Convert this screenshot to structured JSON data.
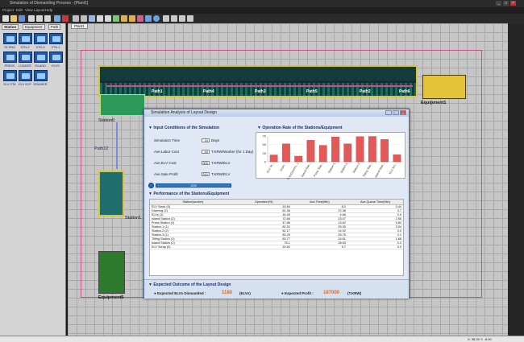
{
  "window": {
    "title": "Simulation of Dismantling Process - [Plant1]",
    "controls": [
      "_",
      "□",
      "×"
    ]
  },
  "menu": [
    "Project",
    "Edit",
    "View",
    "Layout",
    "Help"
  ],
  "left_panel": {
    "tabs": [
      "Station",
      "Equipment",
      "Path"
    ],
    "items": [
      "TILTING",
      "STN-2",
      "STN-3",
      "STN-1",
      "PRESS",
      "LOADER",
      "ISLAND",
      "ELVS",
      "ELV STA",
      "ELV SCP",
      "DRAINER"
    ]
  },
  "canvas_tab": "Plant1",
  "canvas": {
    "paths": [
      "Path1",
      "Path4",
      "Path3",
      "Path5",
      "Path2",
      "Path6"
    ],
    "labels": {
      "station0": "Station0",
      "path12": "Path12",
      "station1": "Station1",
      "equipment1": "Equipment1",
      "equipment6": "Equipment6"
    }
  },
  "modal": {
    "title": "Simulation Analysis of Layout Design",
    "input_section": "Input Conditions of the Simulation",
    "inputs": [
      {
        "label": "Simulation Time",
        "value": "10",
        "unit": "Days"
      },
      {
        "label": "Ave.Labor Cost",
        "value": "50",
        "unit": "T.KRW/Worker (for 1 Day)"
      },
      {
        "label": "Ave.ELV Cost",
        "value": "300",
        "unit": "T.KRW/ELV"
      },
      {
        "label": "Ave.Sale Profit",
        "value": "310",
        "unit": "T.KRW/ELV"
      }
    ],
    "progress_text": "1000",
    "progress_fraction": 1.0,
    "operation_section": "Operation Rate of the Stations/Equipment",
    "performance_section": "Performance of the Stations/Equipment",
    "table": {
      "headers": [
        "Station(worker)",
        "Operation(%)",
        "Ave.Time(Min)",
        "Ave.Queue Time(Min)"
      ],
      "rows": [
        [
          "ELV Stack (0)",
          "19.84",
          "8.0",
          "0.44"
        ],
        [
          "Draining (2)",
          "62.36",
          "22.38",
          "4.7"
        ],
        [
          "ELVs (1)",
          "16.45",
          "4.66",
          "0.0"
        ],
        [
          "Island Station (2)",
          "72.66",
          "23.07",
          "2.56"
        ],
        [
          "Press Station (1)",
          "47.86",
          "13.62",
          "9.84"
        ],
        [
          "Station-1 (1)",
          "82.52",
          "26.35",
          "3.34"
        ],
        [
          "Station-2 (2)",
          "52.17",
          "14.92",
          "0.0"
        ],
        [
          "Station-3 (1)",
          "83.29",
          "25.75",
          "2.1"
        ],
        [
          "Tilting Station (1)",
          "83.77",
          "24.61",
          "1.68"
        ],
        [
          "Island Station (2)",
          "75.1",
          "28.63",
          "0.0"
        ],
        [
          "ELV Scrap (0)",
          "20.62",
          "5.7",
          "0.0"
        ]
      ]
    },
    "outcome_section": "Expected Outcome of the Layout Design",
    "outcome": {
      "dismantled_label": "Expected ELVs Dismantled :",
      "dismantled_value": "1180",
      "dismantled_unit": "(ELVs)",
      "profit_label": "Expected Profit :",
      "profit_value": "187000",
      "profit_unit": "(T.KRW)"
    }
  },
  "chart_data": {
    "type": "bar",
    "title": "",
    "ylim": [
      0,
      75
    ],
    "yticks": [
      0,
      25,
      50,
      75
    ],
    "categories": [
      "ELV St...",
      "Drain...",
      "ELVs(Dismin...)",
      "Island Stat...",
      "Press Stat...",
      "Station-1",
      "Station-2",
      "Station-3",
      "Tilting Stat...",
      "Island Stati...",
      "ELV Scr..."
    ],
    "values": [
      19.84,
      52.36,
      16.45,
      62.66,
      47.86,
      72.52,
      52.17,
      73.29,
      73.77,
      65.1,
      20.62
    ],
    "bar_color": "#e2595a"
  },
  "status": {
    "coords": "X: 38.20  Y: -8.90"
  }
}
